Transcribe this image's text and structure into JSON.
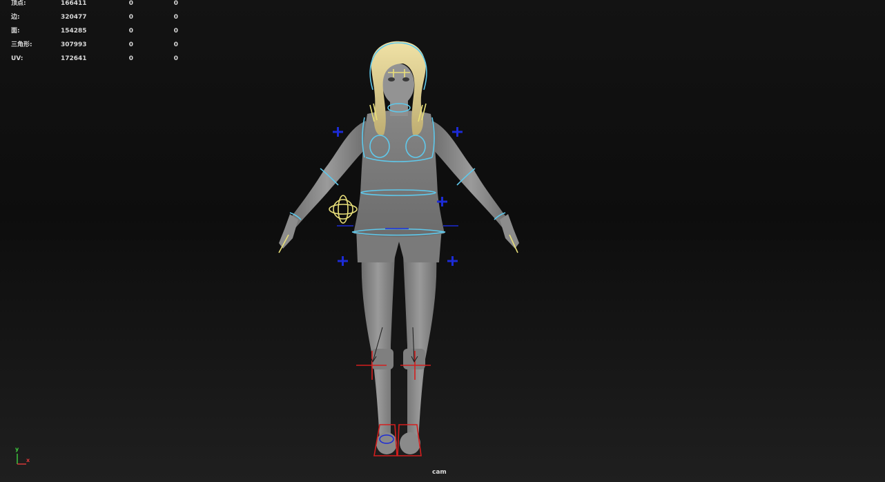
{
  "hud": {
    "rows": [
      {
        "label": "顶点:",
        "v1": "166411",
        "v2": "0",
        "v3": "0"
      },
      {
        "label": "边:",
        "v1": "320477",
        "v2": "0",
        "v3": "0"
      },
      {
        "label": "面:",
        "v1": "154285",
        "v2": "0",
        "v3": "0"
      },
      {
        "label": "三角形:",
        "v1": "307993",
        "v2": "0",
        "v3": "0"
      },
      {
        "label": "UV:",
        "v1": "172641",
        "v2": "0",
        "v3": "0"
      }
    ]
  },
  "viewport": {
    "camera_label": "cam",
    "axis_y": "y",
    "axis_x": "x"
  },
  "colors": {
    "rig_cyan": "#5fc9ec",
    "rig_yellow": "#e9e07a",
    "rig_blue": "#1c2bd6",
    "rig_red": "#d41e1e",
    "model_gray": "#8a8a8a",
    "hair": "#d9c98a",
    "axis_y": "#3fcf3f",
    "axis_x": "#e03a3a"
  },
  "icons": [
    "cross-control-icon",
    "pole-vector-icon",
    "view-axis-icon"
  ]
}
